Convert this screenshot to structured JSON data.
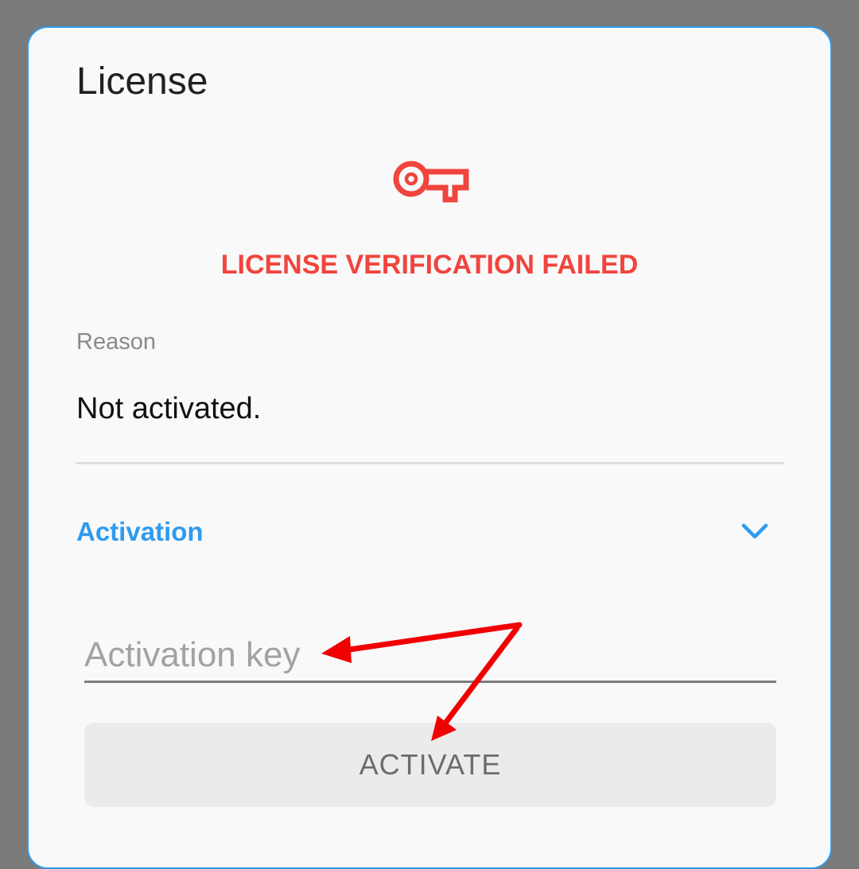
{
  "dialog": {
    "title": "License"
  },
  "status": {
    "icon": "key-icon",
    "title": "LICENSE VERIFICATION FAILED",
    "color": "#f0453e"
  },
  "reason": {
    "label": "Reason",
    "value": "Not activated."
  },
  "activation": {
    "section_title": "Activation",
    "expand_icon": "chevron-down-icon",
    "key_input": {
      "placeholder": "Activation key",
      "value": ""
    },
    "button_label": "ACTIVATE"
  },
  "colors": {
    "accent": "#2e9bf0",
    "error": "#f0453e",
    "annotation": "#f00000"
  },
  "annotation": {
    "icon": "arrow-annotation"
  }
}
